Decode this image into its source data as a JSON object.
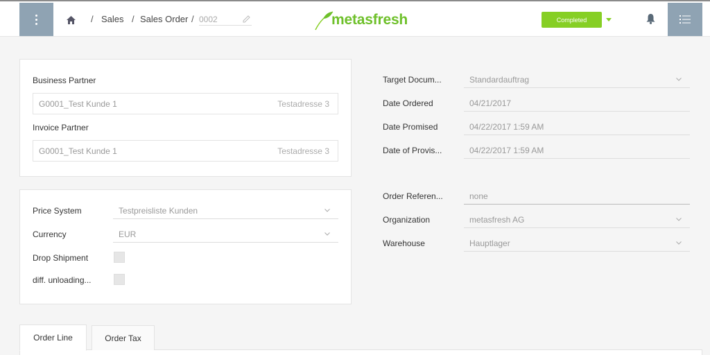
{
  "header": {
    "breadcrumb": [
      "Sales",
      "Sales Order"
    ],
    "document_no": "0002",
    "logo_text": "metasfresh",
    "status": "Completed",
    "icons": {
      "menu": "more-vert-icon",
      "home": "home-icon",
      "edit": "pencil-icon",
      "notifications": "bell-icon",
      "side_list": "list-icon"
    },
    "colors": {
      "accent": "#86cf24",
      "sidebar_button": "#8fa3b3"
    }
  },
  "partner_panel": {
    "business_partner_label": "Business Partner",
    "business_partner_value": "G0001_Test Kunde 1",
    "business_partner_address": "Testadresse 3",
    "invoice_partner_label": "Invoice Partner",
    "invoice_partner_value": "G0001_Test Kunde 1",
    "invoice_partner_address": "Testadresse 3"
  },
  "pricing_panel": {
    "price_system_label": "Price System",
    "price_system_value": "Testpreisliste Kunden",
    "currency_label": "Currency",
    "currency_value": "EUR",
    "drop_shipment_label": "Drop Shipment",
    "diff_unloading_label": "diff. unloading..."
  },
  "details": {
    "target_doc_label": "Target Docum...",
    "target_doc_value": "Standardauftrag",
    "date_ordered_label": "Date Ordered",
    "date_ordered_value": "04/21/2017",
    "date_promised_label": "Date Promised",
    "date_promised_value": "04/22/2017 1:59 AM",
    "date_prov_label": "Date of Provis...",
    "date_prov_value": "04/22/2017 1:59 AM",
    "order_ref_label": "Order Referen...",
    "order_ref_value": "none",
    "organization_label": "Organization",
    "organization_value": "metasfresh AG",
    "warehouse_label": "Warehouse",
    "warehouse_value": "Hauptlager"
  },
  "tabs": [
    {
      "label": "Order Line"
    },
    {
      "label": "Order Tax"
    }
  ]
}
